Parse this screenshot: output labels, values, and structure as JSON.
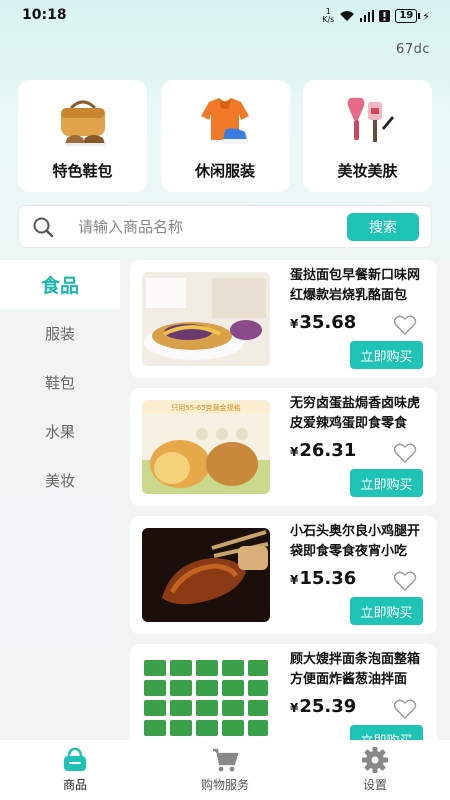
{
  "status": {
    "time": "10:18",
    "netspeed_value": "1",
    "netspeed_unit": "K/s",
    "battery": "19"
  },
  "top_code": "67dc",
  "categories": [
    {
      "label": "特色鞋包",
      "icon": "bag-shoes-icon"
    },
    {
      "label": "休闲服装",
      "icon": "clothes-icon"
    },
    {
      "label": "美妆美肤",
      "icon": "cosmetics-icon"
    }
  ],
  "search": {
    "placeholder": "请输入商品名称",
    "button": "搜索"
  },
  "sidebar": {
    "items": [
      "食品",
      "服装",
      "鞋包",
      "水果",
      "美妆"
    ],
    "active": 0
  },
  "products": [
    {
      "title": "蛋挞面包早餐新口味网红爆款岩烧乳酪面包",
      "currency": "¥",
      "price": "35.68",
      "buy": "立即购买"
    },
    {
      "title": "无穷卤蛋盐焗香卤味虎皮爱辣鸡蛋即食零食",
      "currency": "¥",
      "price": "26.31",
      "buy": "立即购买",
      "img_text": "只用55-65克黄金规格"
    },
    {
      "title": "小石头奥尔良小鸡腿开袋即食零食夜宵小吃",
      "currency": "¥",
      "price": "15.36",
      "buy": "立即购买"
    },
    {
      "title": "顾大嫂拌面条泡面整箱方便面炸酱葱油拌面",
      "currency": "¥",
      "price": "25.39",
      "buy": "立即购买"
    }
  ],
  "tabbar": [
    {
      "label": "商品",
      "icon": "basket-icon",
      "active": true
    },
    {
      "label": "购物服务",
      "icon": "cart-icon",
      "active": false
    },
    {
      "label": "设置",
      "icon": "gear-icon",
      "active": false
    }
  ],
  "colors": {
    "accent": "#1fc3b5",
    "active_text": "#1fb9ab"
  }
}
